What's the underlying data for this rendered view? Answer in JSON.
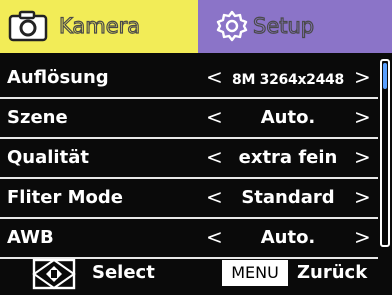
{
  "tabs": {
    "camera_label": "Kamera",
    "setup_label": "Setup",
    "camera_icon": "camera-icon",
    "setup_icon": "gear-icon"
  },
  "settings": [
    {
      "label": "Auflösung",
      "value": "8M 3264x2448"
    },
    {
      "label": "Szene",
      "value": "Auto."
    },
    {
      "label": "Qualität",
      "value": "extra fein"
    },
    {
      "label": "Fliter Mode",
      "value": "Standard"
    },
    {
      "label": "AWB",
      "value": "Auto."
    }
  ],
  "arrows": {
    "left": "<",
    "right": ">"
  },
  "footer": {
    "nav_icon": "dpad-icon",
    "select_label": "Select",
    "menu_key": "MENU",
    "back_label": "Zurück"
  },
  "scroll": {
    "position": 0.0
  },
  "colors": {
    "camera_tab": "#f2ec57",
    "setup_tab": "#8b74c8",
    "background": "#0a0a0a",
    "scroll_thumb": "#5aa0ff"
  }
}
